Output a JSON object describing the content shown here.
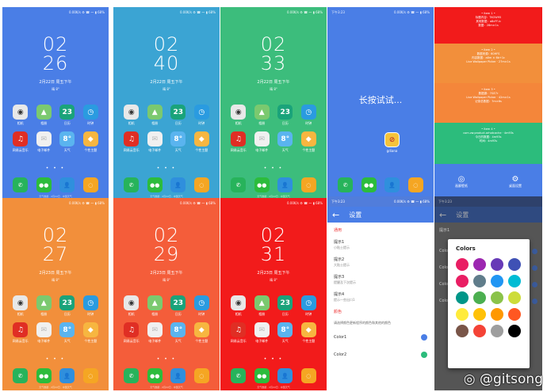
{
  "lockscreens": [
    {
      "bg": "#4a7ee6",
      "time_h": "02",
      "time_m": "26",
      "date": "2月22日 周五下午",
      "weather": "晴 8°",
      "status": "0.00K/s ⚙ ☎ 〜 ▮ 68%",
      "theme": "blue",
      "footer": "天气数据 · 2月22日 · 中国天气"
    },
    {
      "bg": "#3ba4d3",
      "time_h": "02",
      "time_m": "40",
      "date": "2月22日 周五下午",
      "weather": "晴 8°",
      "status": "0.00K/s ⚙ ☎ 〜 ▮ 68%",
      "theme": "cyan",
      "footer": "天气数据 · 2月22日 · 中国天气"
    },
    {
      "bg": "#3cbd7c",
      "time_h": "02",
      "time_m": "33",
      "date": "2月22日 周五下午",
      "weather": "晴 8°",
      "status": "0.00K/s ⚙ ☎ 〜 ▮ 68%",
      "theme": "green",
      "footer": "天气数据 · 2月22日 · 中国天气"
    },
    {
      "bg": "#f28f3b",
      "time_h": "02",
      "time_m": "27",
      "date": "2月23日 周五下午",
      "weather": "晴 8°",
      "status": "0.00K/s ⚙ ☎ 〜 ▮ 68%",
      "theme": "orange",
      "footer": "天气数据 · 2月22日 · 中国天气"
    },
    {
      "bg": "#f45d3a",
      "time_h": "02",
      "time_m": "29",
      "date": "2月23日 周五下午",
      "weather": "晴 8°",
      "status": "0.00K/s ⚙ ☎ 〜 ▮ 68%",
      "theme": "red-orange",
      "footer": "天气数据 · 2月22日 · 中国天气"
    },
    {
      "bg": "#f21b1b",
      "time_h": "02",
      "time_m": "31",
      "date": "2月23日 周五下午",
      "weather": "晴 8°",
      "status": "0.00K/s ⚙ ☎ 〜 ▮ 68%",
      "theme": "red",
      "footer": "天气数据 · 2月22日 · 中国天气"
    }
  ],
  "apps": [
    {
      "label": "相机",
      "icon": "camera-icon",
      "color": "#e8e8e8",
      "glyph": "◉",
      "fg": "#333"
    },
    {
      "label": "相册",
      "icon": "gallery-icon",
      "color": "#7bc96f",
      "glyph": "▲",
      "fg": "#fff"
    },
    {
      "label": "日历",
      "icon": "calendar-icon",
      "color": "#1aa37a",
      "glyph": "23",
      "fg": "#fff"
    },
    {
      "label": "时钟",
      "icon": "clock-icon",
      "color": "#2a9be0",
      "glyph": "◷",
      "fg": "#fff"
    },
    {
      "label": "网易云音乐",
      "icon": "netease-music-icon",
      "color": "#e02e24",
      "glyph": "♫",
      "fg": "#fff"
    },
    {
      "label": "电子邮件",
      "icon": "mail-icon",
      "color": "#f0f0f0",
      "glyph": "✉",
      "fg": "#bbb"
    },
    {
      "label": "天气",
      "icon": "weather-icon",
      "color": "#5ab4ef",
      "glyph": "8°",
      "fg": "#fff"
    },
    {
      "label": "个性主题",
      "icon": "theme-icon",
      "color": "#f7b640",
      "glyph": "◆",
      "fg": "#fff"
    }
  ],
  "dock": [
    {
      "icon": "phone-icon",
      "color": "#27b35b",
      "glyph": "✆"
    },
    {
      "icon": "wechat-icon",
      "color": "#2cbc3c",
      "glyph": "●●"
    },
    {
      "icon": "contacts-icon",
      "color": "#2f8fdd",
      "glyph": "👤"
    },
    {
      "icon": "messages-icon",
      "color": "#f5a623",
      "glyph": "◌"
    }
  ],
  "longpress": {
    "bg": "#4a7ee6",
    "text": "长按试试...",
    "status": "0.00K/s ⚙ ☎ 〜 ▮ 68%",
    "time": "下午3:23",
    "app_label": "gdiana"
  },
  "bands": [
    {
      "color": "#f21b1b",
      "title": "• Item 1 •",
      "l1": "标题内容：TKOW95",
      "l2": "其他数据：a8cFF-b",
      "l3": "数据：28m×1s"
    },
    {
      "color": "#f28f3b",
      "title": "• Item 2 •",
      "l1": "数据来源：60HFS",
      "l2": "内容数据：a8m × 6b+1c",
      "l3": "Live Wallpaper Picker · 27m×1s"
    },
    {
      "color": "#f4863a",
      "title": "• Item 3 •",
      "l1": "数据源：7GE7r",
      "l2": "Live Wallpaper Picker · 42m×1s",
      "l3": "记录总数据：7m×6s"
    },
    {
      "color": "#2cbc7c",
      "title": "• Item 4 •",
      "l1": "com.zw.product.arhotcache · 4m93s",
      "l2": "今日的数据：4m93s",
      "l3": "时间：4m93s"
    }
  ],
  "band_bottom": {
    "color": "#4a7ee6",
    "left": "画廊壁纸",
    "right": "桌面设置"
  },
  "settings": {
    "title": "设置",
    "status_time": "下午3:23",
    "status": "0.00K/s ⚙ ☎ 〜 ▮ 68%",
    "section": "通用",
    "items": [
      {
        "title": "提示1",
        "sub": "小贴士提示"
      },
      {
        "title": "提示2",
        "sub": "大贴士提示"
      },
      {
        "title": "提示3",
        "sub": "提醒及下次提示"
      },
      {
        "title": "提示4",
        "sub": "提示一些出口1"
      }
    ],
    "section2": "颜色",
    "desc": "请选择颜色更新程序的颜色和其他的颜色",
    "colors": [
      {
        "title": "Color1",
        "dot": "#4a7ee6"
      },
      {
        "title": "Color2",
        "dot": "#2cbc7c"
      }
    ]
  },
  "dialog": {
    "title": "Colors",
    "swatches": [
      "#e91e63",
      "#9c27b0",
      "#673ab7",
      "#3f51b5",
      "#e91e63",
      "#607d8b",
      "#2196f3",
      "#00bcd4",
      "#009688",
      "#4caf50",
      "#8bc34a",
      "#cddc39",
      "#ffeb3b",
      "#ffc107",
      "#ff9800",
      "#ff5722",
      "#795548",
      "#f44336",
      "#9e9e9e",
      "#000000"
    ]
  },
  "dim_settings": {
    "title": "设置",
    "status_time": "下午3:23",
    "labels": [
      "提示1",
      "提示2",
      "提示3",
      "提示4"
    ],
    "colors": [
      "Colo",
      "Colo",
      "Colo",
      "Colo"
    ]
  },
  "watermark": "@gitsong"
}
